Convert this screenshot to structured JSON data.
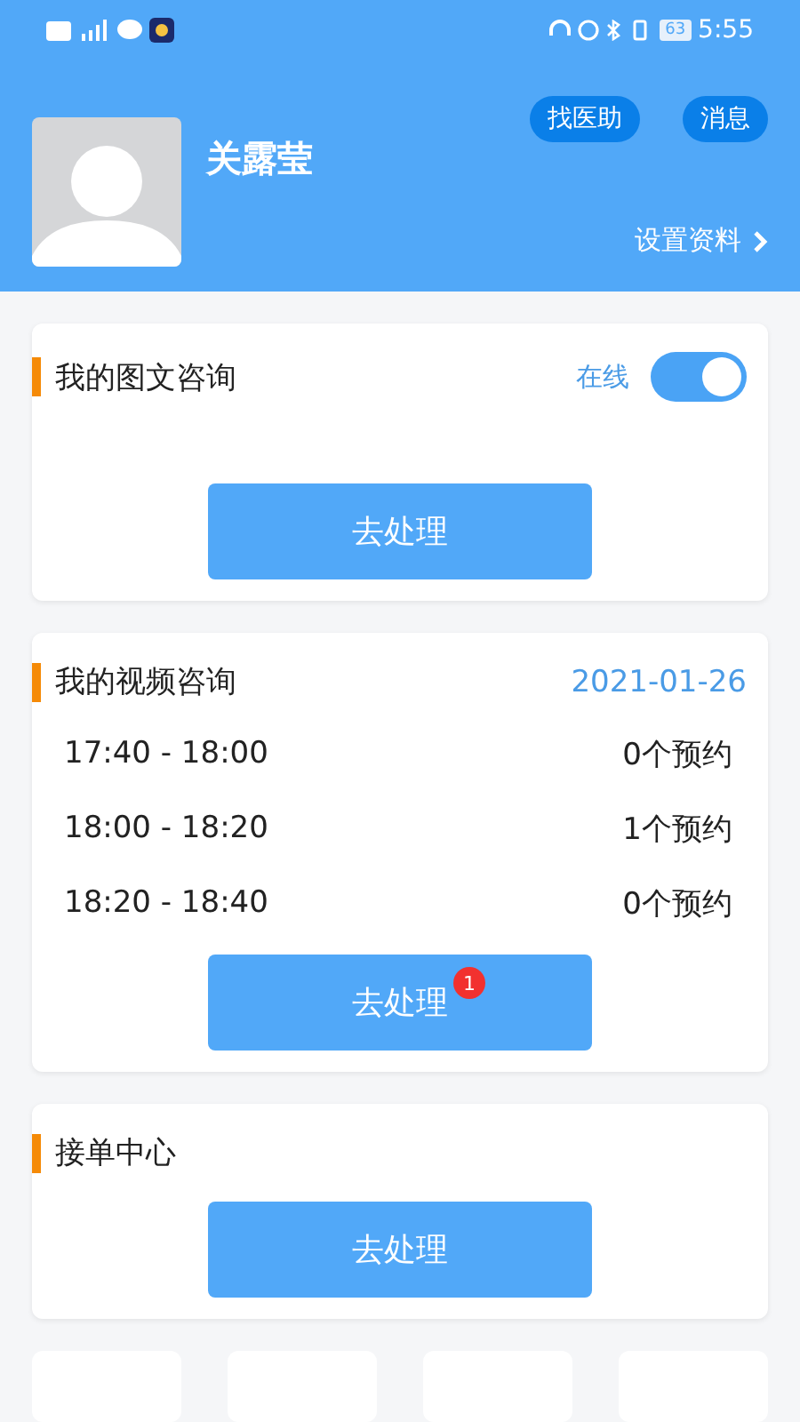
{
  "status_bar": {
    "time": "5:55",
    "battery": "63"
  },
  "profile": {
    "name": "关露莹",
    "buttons": [
      "找医助",
      "消息"
    ],
    "settings_link": "设置资料"
  },
  "text_consult": {
    "title": "我的图文咨询",
    "status_label": "在线",
    "online": true,
    "action": "去处理"
  },
  "video_consult": {
    "title": "我的视频咨询",
    "date": "2021-01-26",
    "slots": [
      {
        "time": "17:40 - 18:00",
        "count": "0个预约"
      },
      {
        "time": "18:00 - 18:20",
        "count": "1个预约"
      },
      {
        "time": "18:20 - 18:40",
        "count": "0个预约"
      }
    ],
    "action": "去处理",
    "badge": "1"
  },
  "order_center": {
    "title": "接单中心",
    "action": "去处理"
  },
  "bottom_tiles": [
    {
      "kind": "tile"
    },
    {
      "kind": "tile"
    },
    {
      "kind": "tile"
    },
    {
      "kind": "tile"
    }
  ]
}
